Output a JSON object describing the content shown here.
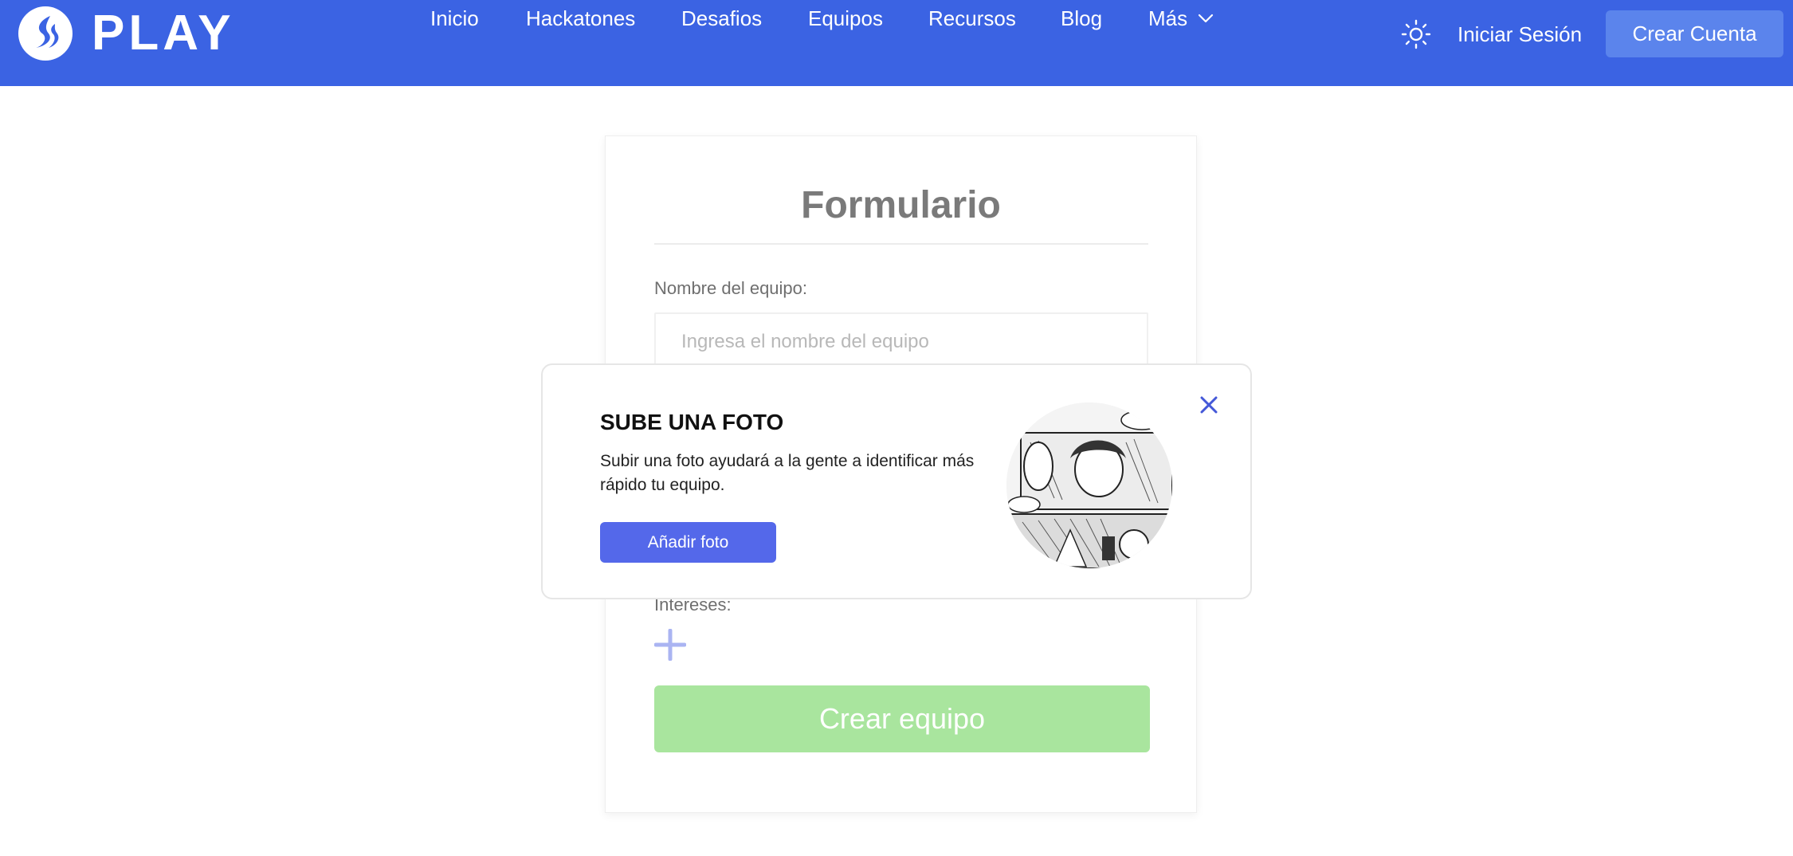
{
  "brand": {
    "name": "PLAY",
    "logo_icon": "play-flame-logo-icon"
  },
  "nav": {
    "items": [
      {
        "label": "Inicio"
      },
      {
        "label": "Hackatones"
      },
      {
        "label": "Desafios"
      },
      {
        "label": "Equipos"
      },
      {
        "label": "Recursos"
      },
      {
        "label": "Blog"
      },
      {
        "label": "Más",
        "icon": "chevron-down-icon"
      }
    ]
  },
  "header_actions": {
    "theme_icon": "sun-icon",
    "login_label": "Iniciar Sesión",
    "signup_label": "Crear Cuenta"
  },
  "form": {
    "title": "Formulario",
    "team_name_label": "Nombre del equipo:",
    "team_name_value": "",
    "team_name_placeholder": "Ingresa el nombre del equipo",
    "interests_label": "Intereses:",
    "add_interest_icon": "plus-icon",
    "submit_label": "Crear equipo"
  },
  "popup": {
    "title": "SUBE UNA FOTO",
    "text": "Subir una foto ayudará a la gente a identificar más rápido tu equipo.",
    "button_label": "Añadir foto",
    "close_icon": "close-icon",
    "image": "manga-panel-illustration"
  },
  "colors": {
    "header_bg": "#3b63e3",
    "signup_bg": "#5b84ec",
    "popup_button": "#5468ea",
    "submit_disabled": "#a9e59e",
    "plus_icon": "#aab4f2",
    "close_icon": "#4458d8"
  }
}
